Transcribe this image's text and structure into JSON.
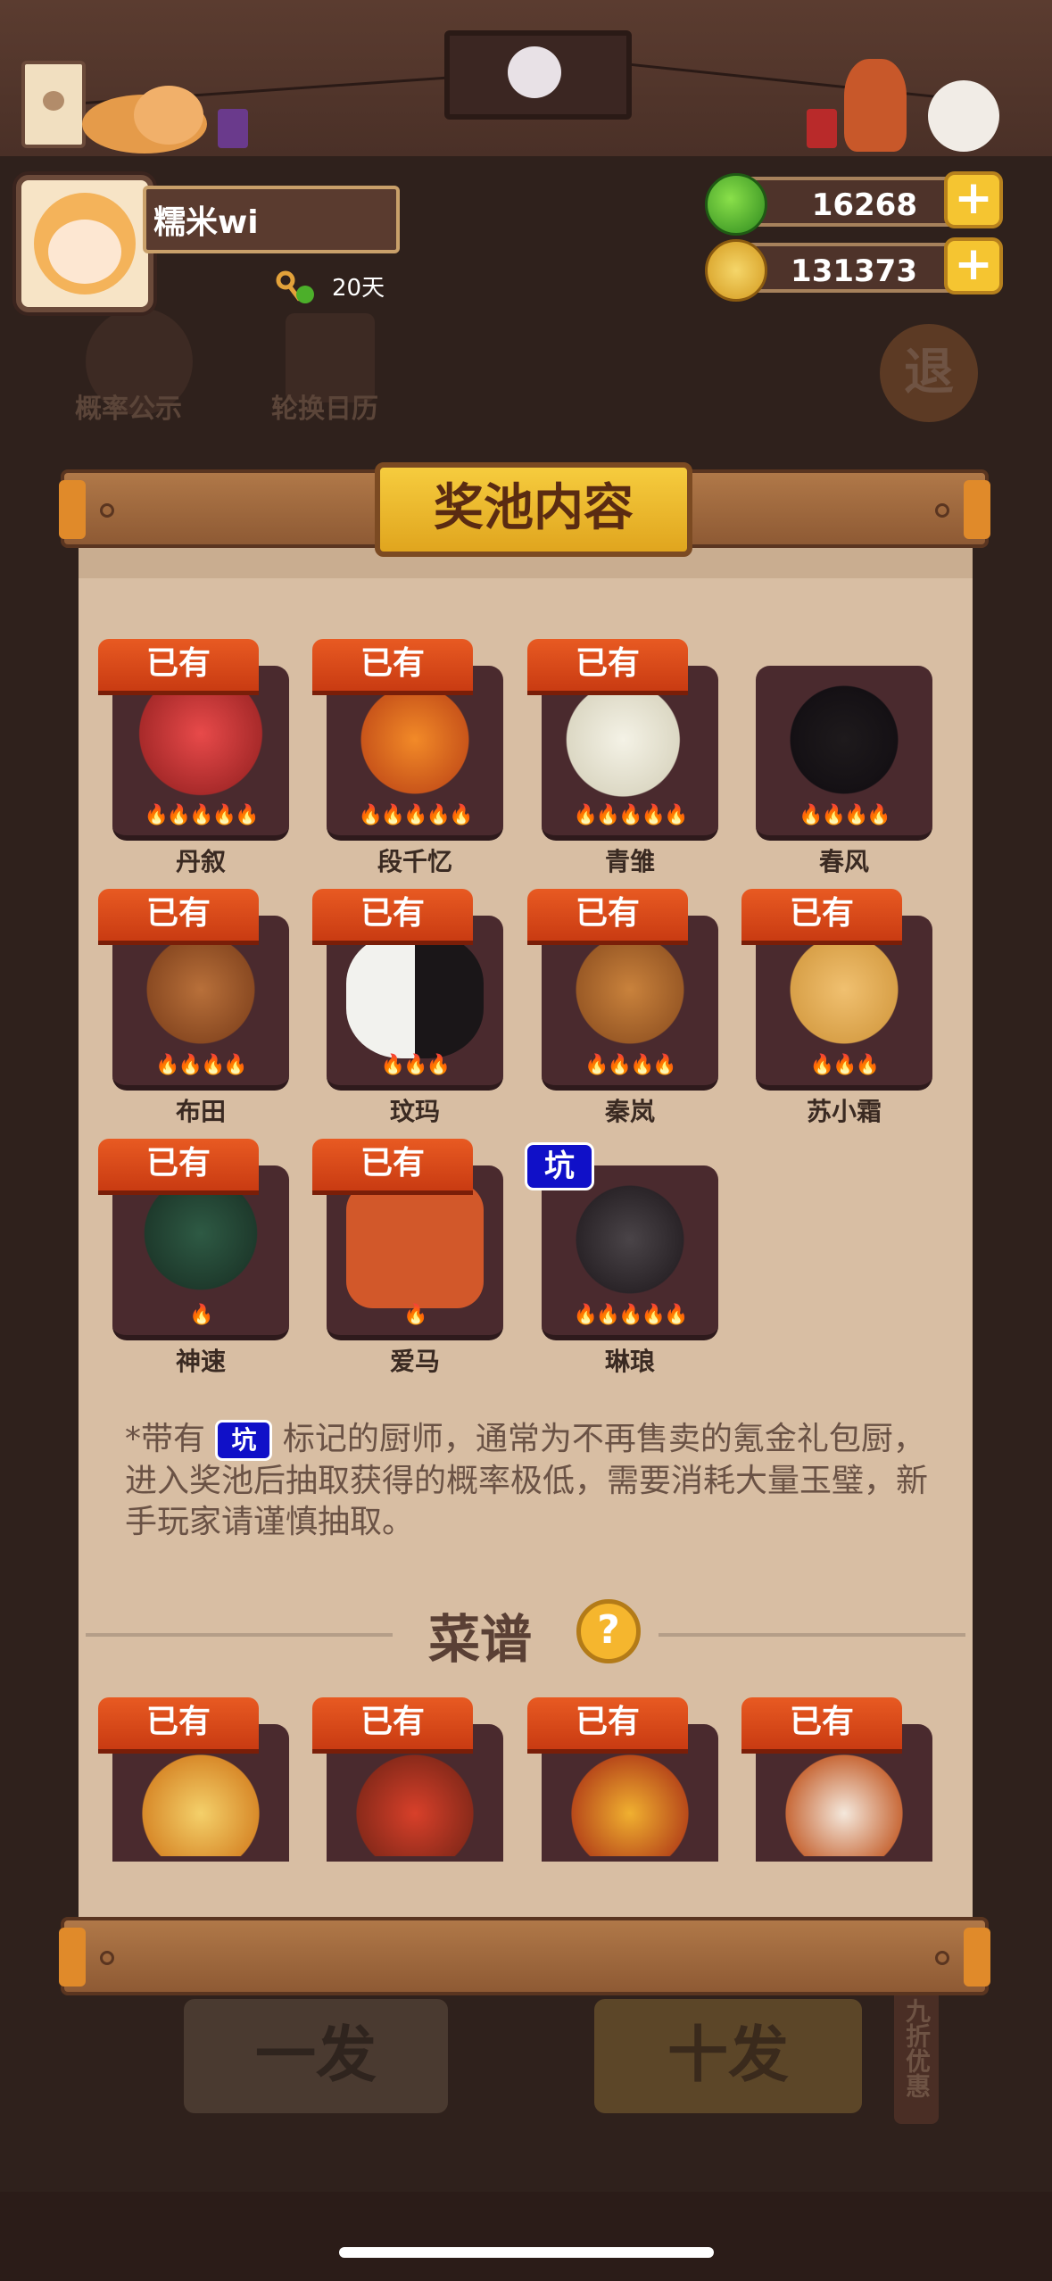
{
  "profile": {
    "name": "糯米wi",
    "days": "20天"
  },
  "currency": {
    "jade": "16268",
    "coins": "131373",
    "plus": "+"
  },
  "background_tabs": {
    "probability": "概率公示",
    "rotation_calendar": "轮换日历",
    "exit": "退"
  },
  "popup": {
    "title": "奖池内容",
    "owned_label": "已有",
    "pit_label": "坑",
    "chefs": [
      {
        "name": "丹叙",
        "owned": true,
        "flames": 5
      },
      {
        "name": "段千忆",
        "owned": true,
        "flames": 5
      },
      {
        "name": "青雏",
        "owned": true,
        "flames": 5
      },
      {
        "name": "春风",
        "owned": false,
        "flames": 4
      },
      {
        "name": "布田",
        "owned": true,
        "flames": 4
      },
      {
        "name": "玟玛",
        "owned": true,
        "flames": 3
      },
      {
        "name": "秦岚",
        "owned": true,
        "flames": 4
      },
      {
        "name": "苏小霜",
        "owned": true,
        "flames": 3
      },
      {
        "name": "神速",
        "owned": true,
        "flames": 1
      },
      {
        "name": "爱马",
        "owned": true,
        "flames": 1
      },
      {
        "name": "琳琅",
        "owned": false,
        "pit": true,
        "flames": 5
      }
    ],
    "note_prefix": "*带有",
    "note_badge": "坑",
    "note_rest": "标记的厨师，通常为不再售卖的氪金礼包厨，进入奖池后抽取获得的概率极低，需要消耗大量玉璧，新手玩家请谨慎抽取。",
    "recipes_title": "菜谱",
    "help": "?",
    "recipes": [
      {
        "owned": true
      },
      {
        "owned": true
      },
      {
        "owned": true
      },
      {
        "owned": true
      }
    ]
  },
  "bottom": {
    "discount": "九折优惠",
    "draw_one": "一发",
    "draw_ten": "十发"
  },
  "colors": {
    "owned_tag": "#e0481a",
    "pit_tag": "#1010c8",
    "panel": "#d8bea3",
    "card": "#4a2a2e",
    "gold": "#f5c531"
  }
}
